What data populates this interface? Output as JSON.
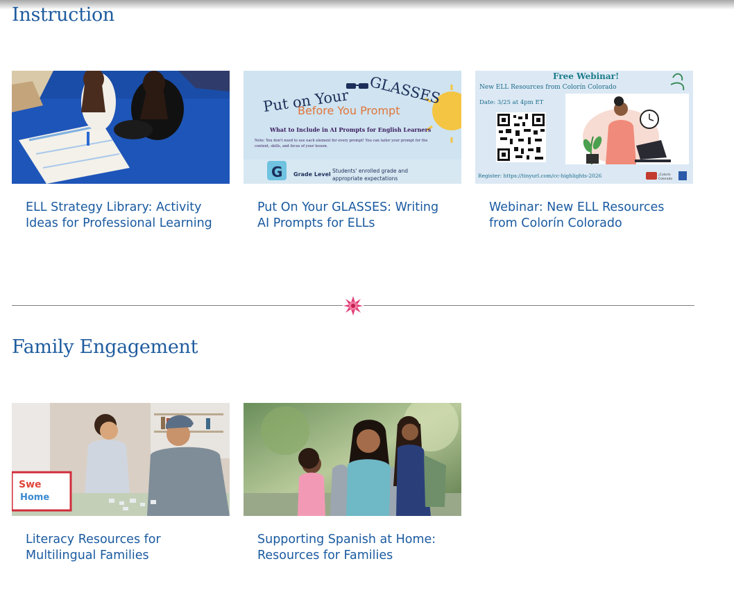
{
  "sections": [
    {
      "title": "Instruction",
      "cards": [
        {
          "title": "ELL Strategy Library: Activity Ideas for Professional Learning"
        },
        {
          "title": "Put On Your GLASSES: Writing AI Prompts for ELLs",
          "image_text": {
            "line1": "Put on Your",
            "line1b": "GLASSES",
            "line2": "Before You Prompt",
            "heading": "What to Include in AI Prompts for English Learners",
            "note1": "Note: You don't need to use each element for every prompt! You can tailor your prompt for the",
            "note2": "content, skills, and focus of your lesson.",
            "letter": "G",
            "label": "Grade Level",
            "desc1": "Students' enrolled grade and",
            "desc2": "appropriate expectations"
          }
        },
        {
          "title": "Webinar: New ELL Resources from Colorín Colorado",
          "image_text": {
            "heading": "Free Webinar!",
            "subheading": "New ELL Resources from Colorín Colorado",
            "date": "Date: 3/25 at 4pm ET",
            "register": "Register: https://tinyurl.com/cc-highlights-2026",
            "logo1": "¡Colorín",
            "logo2": "Colorado"
          }
        }
      ]
    },
    {
      "title": "Family Engagement",
      "cards": [
        {
          "title": "Literacy Resources for Multilingual Families",
          "image_text": {
            "word1": "Swe",
            "word2": "Home"
          }
        },
        {
          "title": "Supporting Spanish at Home: Resources for Families"
        }
      ]
    }
  ],
  "colors": {
    "link": "#1a5aa0",
    "heading": "#1f5c9e",
    "divider": "#7d7d7d",
    "flower": "#e0437a"
  },
  "icons": {
    "divider": "flower-icon"
  }
}
